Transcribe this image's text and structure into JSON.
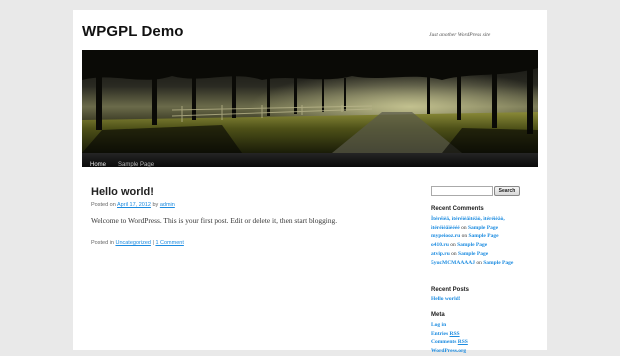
{
  "site": {
    "title": "WPGPL Demo",
    "description": "Just another WordPress site"
  },
  "nav": {
    "items": [
      {
        "label": "Home"
      },
      {
        "label": "Sample Page"
      }
    ]
  },
  "post": {
    "title": "Hello world!",
    "meta_prefix": "Posted on",
    "date": "April 17, 2012",
    "meta_by": "by",
    "author": "admin",
    "content": "Welcome to WordPress. This is your first post. Edit or delete it, then start blogging.",
    "util_prefix": "Posted in",
    "category": "Uncategorized",
    "separator": "|",
    "comments": "1 Comment"
  },
  "sidebar": {
    "search": {
      "value": "",
      "button_label": "Search"
    },
    "recent_comments": {
      "title": "Recent Comments",
      "items": [
        {
          "author_line1": "Ìtéréìèä, ìtéréìèäìtéäò, ìtéréìèäò,",
          "author_line2": "ìtéréìèäìèééé",
          "on": "on",
          "post": "Sample Page"
        },
        {
          "author_line1": "mypeiooz.ru",
          "on": "on",
          "post": "Sample Page"
        },
        {
          "author_line1": "o410.ru",
          "on": "on",
          "post": "Sample Page"
        },
        {
          "author_line1": "atvip.ru",
          "on": "on",
          "post": "Sample Page"
        },
        {
          "author_line1": "5yucMCMAAAAJ",
          "on": "on",
          "post": "Sample Page"
        }
      ]
    },
    "recent_posts": {
      "title": "Recent Posts",
      "items": [
        {
          "label": "Hello world!"
        }
      ]
    },
    "meta": {
      "title": "Meta",
      "items": [
        {
          "label": "Log in"
        },
        {
          "label_prefix": "Entries",
          "label_suffix": "RSS"
        },
        {
          "label_prefix": "Comments",
          "label_suffix": "RSS"
        },
        {
          "label": "WordPress.org"
        }
      ]
    }
  }
}
